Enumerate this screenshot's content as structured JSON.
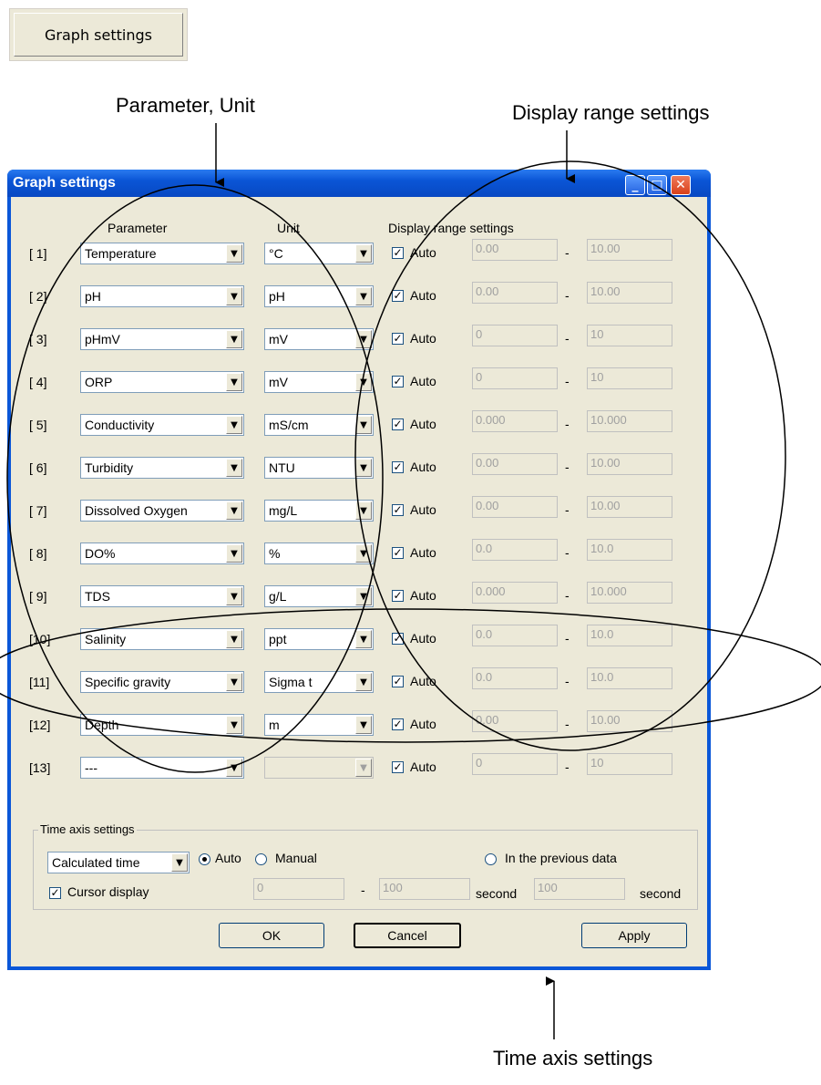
{
  "top_button": {
    "label": "Graph settings"
  },
  "callouts": {
    "param_unit": "Parameter, Unit",
    "display_range": "Display range settings",
    "time_axis": "Time axis settings"
  },
  "window": {
    "title": "Graph settings",
    "headers": {
      "parameter": "Parameter",
      "unit": "Unit",
      "display_range": "Display range settings"
    },
    "auto_label": "Auto",
    "dash": "-",
    "rows": [
      {
        "index": "[ 1]",
        "parameter": "Temperature",
        "unit": "°C",
        "auto": true,
        "min": "0.00",
        "max": "10.00"
      },
      {
        "index": "[ 2]",
        "parameter": "pH",
        "unit": "pH",
        "auto": true,
        "min": "0.00",
        "max": "10.00"
      },
      {
        "index": "[ 3]",
        "parameter": "pHmV",
        "unit": "mV",
        "auto": true,
        "min": "0",
        "max": "10"
      },
      {
        "index": "[ 4]",
        "parameter": "ORP",
        "unit": "mV",
        "auto": true,
        "min": "0",
        "max": "10"
      },
      {
        "index": "[ 5]",
        "parameter": "Conductivity",
        "unit": "mS/cm",
        "auto": true,
        "min": "0.000",
        "max": "10.000"
      },
      {
        "index": "[ 6]",
        "parameter": "Turbidity",
        "unit": "NTU",
        "auto": true,
        "min": "0.00",
        "max": "10.00"
      },
      {
        "index": "[ 7]",
        "parameter": "Dissolved Oxygen",
        "unit": "mg/L",
        "auto": true,
        "min": "0.00",
        "max": "10.00"
      },
      {
        "index": "[ 8]",
        "parameter": "DO%",
        "unit": "%",
        "auto": true,
        "min": "0.0",
        "max": "10.0"
      },
      {
        "index": "[ 9]",
        "parameter": "TDS",
        "unit": "g/L",
        "auto": true,
        "min": "0.000",
        "max": "10.000"
      },
      {
        "index": "[10]",
        "parameter": "Salinity",
        "unit": "ppt",
        "auto": true,
        "min": "0.0",
        "max": "10.0"
      },
      {
        "index": "[11]",
        "parameter": "Specific gravity",
        "unit": "Sigma t",
        "auto": true,
        "min": "0.0",
        "max": "10.0"
      },
      {
        "index": "[12]",
        "parameter": "Depth",
        "unit": "m",
        "auto": true,
        "min": "0.00",
        "max": "10.00"
      },
      {
        "index": "[13]",
        "parameter": "---",
        "unit": "",
        "unit_disabled": true,
        "auto": true,
        "min": "0",
        "max": "10"
      }
    ],
    "time_axis": {
      "group_label": "Time axis settings",
      "mode_select": "Calculated time",
      "radio_auto": "Auto",
      "radio_manual": "Manual",
      "radio_previous": "In the previous data",
      "selected": "Auto",
      "cursor_display": "Cursor display",
      "cursor_checked": true,
      "range_min": "0",
      "range_max": "100",
      "range_unit": "second",
      "prev_value": "100",
      "prev_unit": "second"
    },
    "buttons": {
      "ok": "OK",
      "cancel": "Cancel",
      "apply": "Apply"
    }
  }
}
